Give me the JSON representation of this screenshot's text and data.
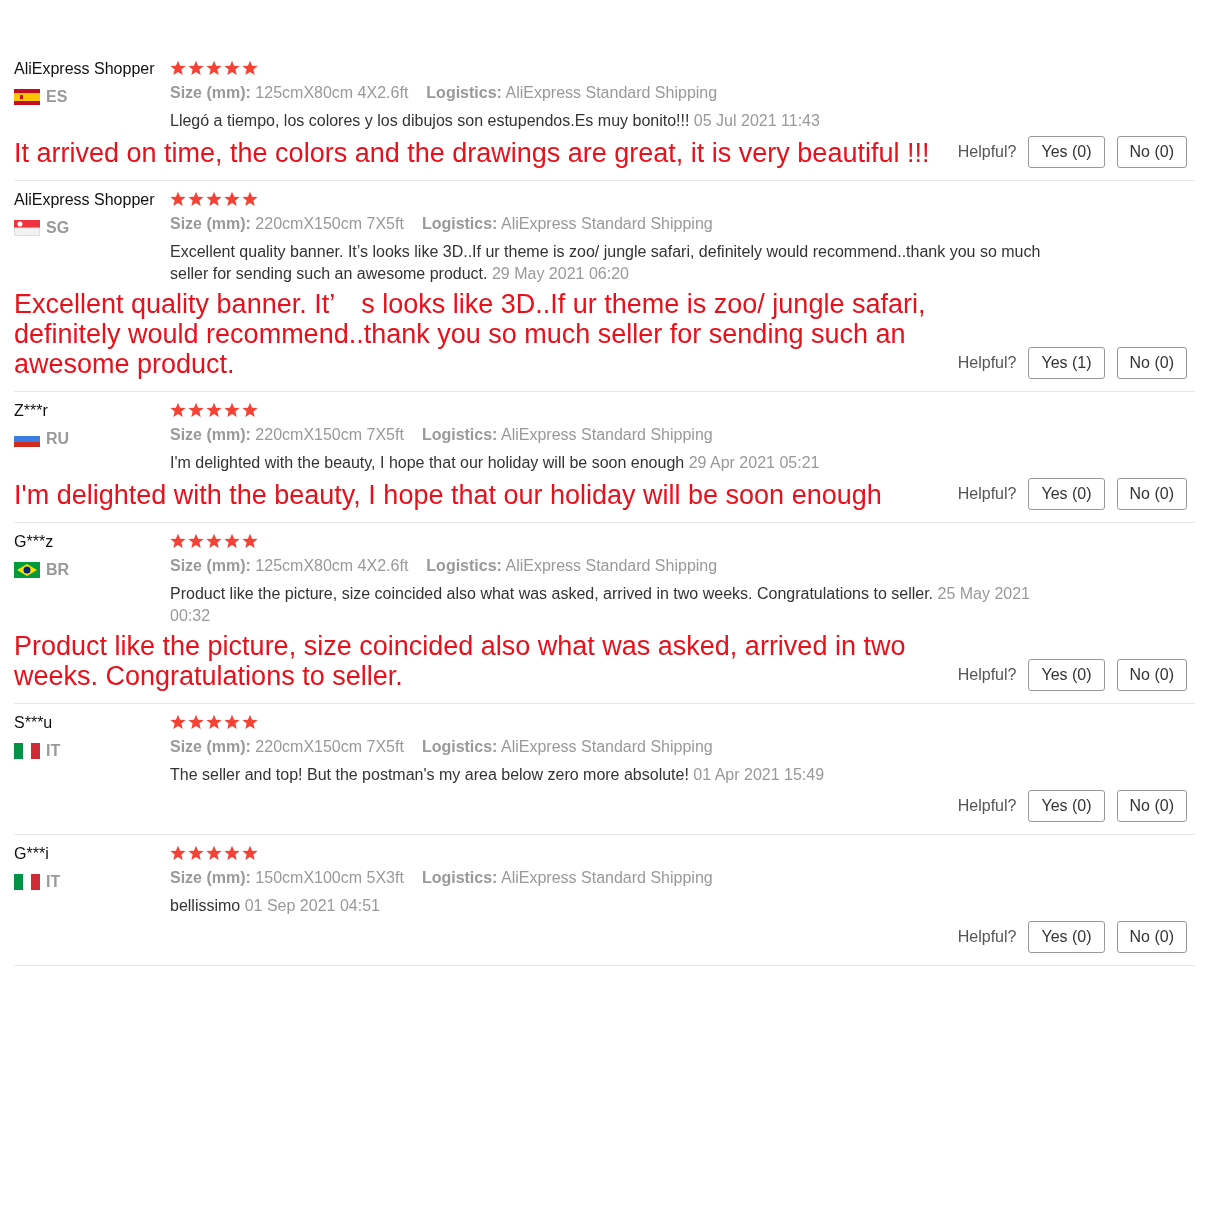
{
  "reviews": [
    {
      "name": "AliExpress Shopper",
      "kind": "es",
      "country": "ES",
      "stars": 5,
      "size_label": "Size (mm):",
      "size": "125cmX80cm 4X2.6ft",
      "logistics_label": "Logistics:",
      "logistics": "AliExpress Standard Shipping",
      "text": "Llegó a tiempo, los colores y los dibujos son estupendos.Es muy bonito!!!",
      "date": "05 Jul 2021 11:43",
      "translation": "It arrived on time, the colors and the drawings are great, it is very beautiful !!!",
      "helpful": "Helpful?",
      "yes": "Yes (0)",
      "no": "No (0)"
    },
    {
      "name": "AliExpress Shopper",
      "kind": "sg",
      "country": "SG",
      "stars": 5,
      "size_label": "Size (mm):",
      "size": "220cmX150cm 7X5ft",
      "logistics_label": "Logistics:",
      "logistics": "AliExpress Standard Shipping",
      "text": "Excellent quality banner. It’s looks like 3D..If ur theme is zoo/ jungle safari, definitely would recommend..thank you so much seller for sending such an awesome product.",
      "date": "29 May 2021 06:20",
      "translation": "Excellent quality banner. It’　s looks like 3D..If ur theme is zoo/ jungle safari, definitely would recommend..thank you so much seller for sending such an awesome product.",
      "helpful": "Helpful?",
      "yes": "Yes (1)",
      "no": "No (0)"
    },
    {
      "name": "Z***r",
      "kind": "ru",
      "country": "RU",
      "stars": 5,
      "size_label": "Size (mm):",
      "size": "220cmX150cm 7X5ft",
      "logistics_label": "Logistics:",
      "logistics": "AliExpress Standard Shipping",
      "text": "I'm delighted with the beauty, I hope that our holiday will be soon enough",
      "date": "29 Apr 2021 05:21",
      "translation": "I'm delighted with the beauty, I hope that our holiday will be soon enough",
      "helpful": "Helpful?",
      "yes": "Yes (0)",
      "no": "No (0)"
    },
    {
      "name": "G***z",
      "kind": "br",
      "country": "BR",
      "stars": 5,
      "size_label": "Size (mm):",
      "size": "125cmX80cm 4X2.6ft",
      "logistics_label": "Logistics:",
      "logistics": "AliExpress Standard Shipping",
      "text": "Product like the picture, size coincided also what was asked, arrived in two weeks. Congratulations to seller.",
      "date": "25 May 2021 00:32",
      "translation": "Product like the picture, size coincided also what was asked, arrived in two weeks. Congratulations to seller.",
      "helpful": "Helpful?",
      "yes": "Yes (0)",
      "no": "No (0)"
    },
    {
      "name": "S***u",
      "kind": "it",
      "country": "IT",
      "stars": 5,
      "size_label": "Size (mm):",
      "size": "220cmX150cm 7X5ft",
      "logistics_label": "Logistics:",
      "logistics": "AliExpress Standard Shipping",
      "text": "The seller and top! But the postman's my area below zero more absolute!",
      "date": "01 Apr 2021 15:49",
      "helpful": "Helpful?",
      "yes": "Yes (0)",
      "no": "No (0)"
    },
    {
      "name": "G***i",
      "kind": "it",
      "country": "IT",
      "stars": 5,
      "size_label": "Size (mm):",
      "size": "150cmX100cm 5X3ft",
      "logistics_label": "Logistics:",
      "logistics": "AliExpress Standard Shipping",
      "text": "bellissimo",
      "date": "01 Sep 2021 04:51",
      "helpful": "Helpful?",
      "yes": "Yes (0)",
      "no": "No (0)"
    }
  ]
}
